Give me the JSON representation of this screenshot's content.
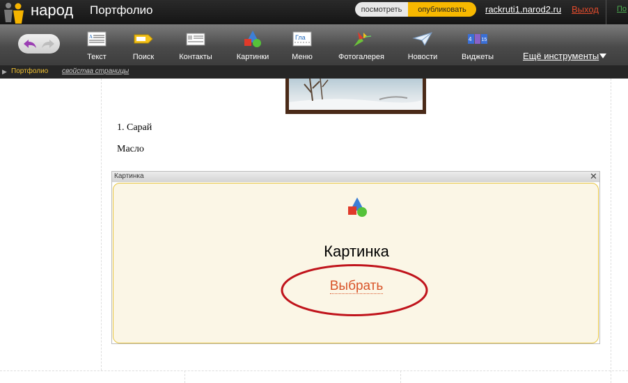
{
  "topbar": {
    "logo_text": "народ",
    "page_title": "Портфолио",
    "view_label": "посмотреть",
    "publish_label": "опубликовать",
    "site_link": "rackruti1.narod2.ru",
    "logout_label": "Выход",
    "cut_label": "По"
  },
  "toolbar": {
    "tools": [
      {
        "label": "Текст",
        "icon": "text-icon"
      },
      {
        "label": "Поиск",
        "icon": "search-icon"
      },
      {
        "label": "Контакты",
        "icon": "contacts-icon"
      },
      {
        "label": "Картинки",
        "icon": "pictures-icon"
      },
      {
        "label": "Меню",
        "icon": "menu-icon"
      },
      {
        "label": "Фотогалерея",
        "icon": "photo-gallery-icon"
      },
      {
        "label": "Новости",
        "icon": "news-icon"
      },
      {
        "label": "Виджеты",
        "icon": "widgets-icon"
      }
    ],
    "more_label": "Ещё инструменты",
    "menu_icon_text": "Гла",
    "widget_icon_text": "4 15"
  },
  "breadcrumb": {
    "portfolio": "Портфолио",
    "page_props": "свойства страницы"
  },
  "content": {
    "text1": "1. Сарай",
    "text2": "Масло"
  },
  "widget": {
    "header_title": "Картинка",
    "close": "✕",
    "label": "Картинка",
    "choose": "Выбрать"
  },
  "colors": {
    "publish": "#f7b800",
    "logout": "#e24b2c",
    "choose_link": "#d9552a",
    "highlight_ellipse": "#c0141c"
  }
}
